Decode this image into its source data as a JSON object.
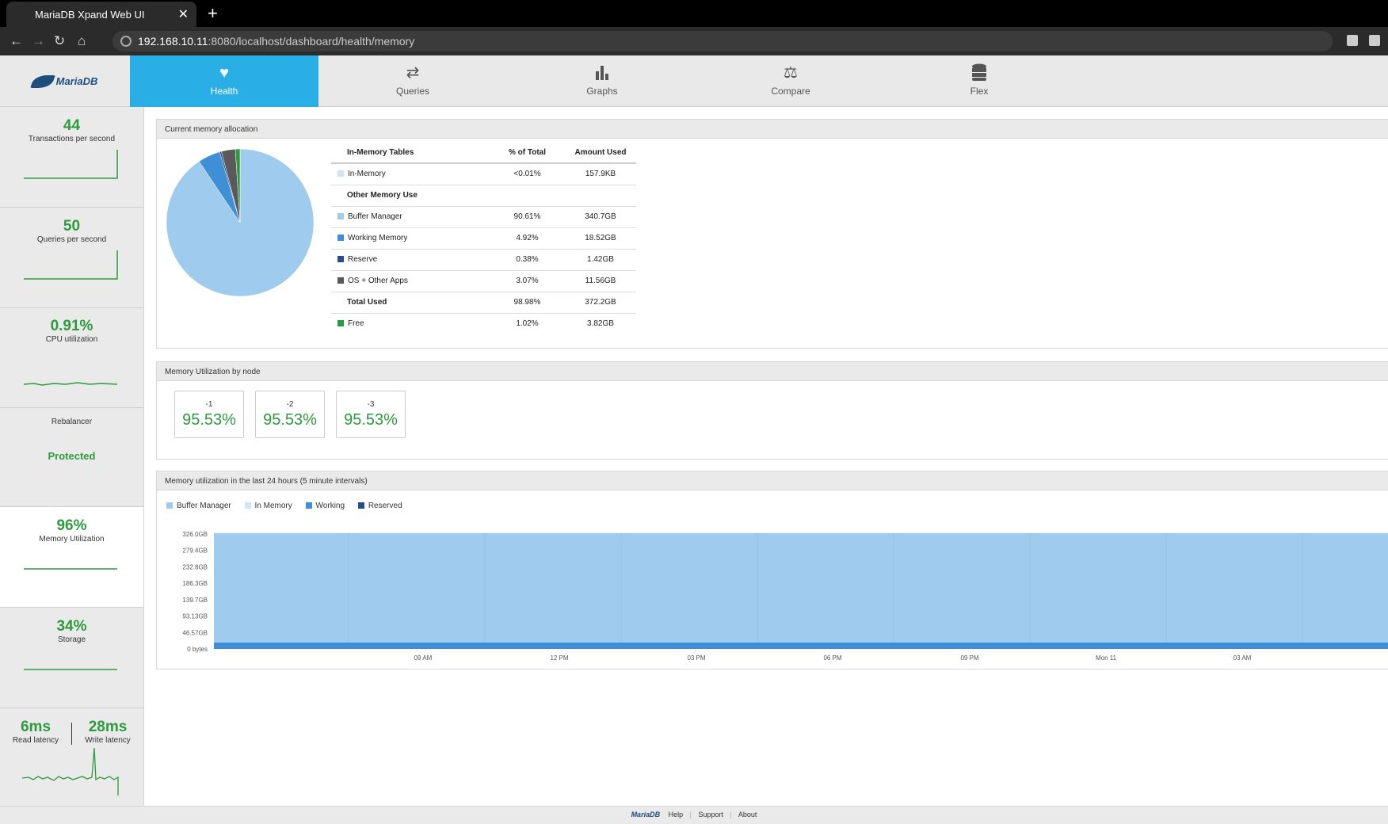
{
  "browser": {
    "tab_title": "MariaDB Xpand Web UI",
    "url_host": "192.168.10.11",
    "url_rest": ":8080/localhost/dashboard/health/memory"
  },
  "app": {
    "logo_text": "MariaDB",
    "nav": [
      {
        "label": "Health",
        "icon": "heart-pulse-icon",
        "active": true
      },
      {
        "label": "Queries",
        "icon": "arrows-icon"
      },
      {
        "label": "Graphs",
        "icon": "bar-chart-icon"
      },
      {
        "label": "Compare",
        "icon": "scales-icon"
      },
      {
        "label": "Flex",
        "icon": "database-icon"
      }
    ]
  },
  "sidebar": {
    "tps": {
      "value": "44",
      "label": "Transactions per second"
    },
    "qps": {
      "value": "50",
      "label": "Queries per second"
    },
    "cpu": {
      "value": "0.91%",
      "label": "CPU utilization"
    },
    "rebalancer": {
      "label": "Rebalancer",
      "value": "Protected"
    },
    "memory": {
      "value": "96%",
      "label": "Memory Utilization"
    },
    "storage": {
      "value": "34%",
      "label": "Storage"
    },
    "latency": {
      "read_value": "6ms",
      "read_label": "Read latency",
      "write_value": "28ms",
      "write_label": "Write latency"
    }
  },
  "allocation": {
    "title": "Current memory allocation",
    "headers": {
      "col1": "In-Memory Tables",
      "col2": "% of Total",
      "col3": "Amount Used"
    },
    "in_memory": {
      "name": "In-Memory",
      "pct": "<0.01%",
      "amount": "157.9KB"
    },
    "other_heading": "Other Memory Use",
    "rows": [
      {
        "name": "Buffer Manager",
        "pct": "90.61%",
        "amount": "340.7GB"
      },
      {
        "name": "Working Memory",
        "pct": "4.92%",
        "amount": "18.52GB"
      },
      {
        "name": "Reserve",
        "pct": "0.38%",
        "amount": "1.42GB"
      },
      {
        "name": "OS + Other Apps",
        "pct": "3.07%",
        "amount": "11.56GB"
      }
    ],
    "total": {
      "name": "Total Used",
      "pct": "98.98%",
      "amount": "372.2GB"
    },
    "free": {
      "name": "Free",
      "pct": "1.02%",
      "amount": "3.82GB"
    },
    "colors": {
      "in_memory": "#cfe6f7",
      "buffer": "#9ecbee",
      "working": "#3f8fd6",
      "reserve": "#2d4a8a",
      "os": "#5a5a5a",
      "free": "#2e9a3e"
    }
  },
  "nodes": {
    "title": "Memory Utilization by node",
    "items": [
      {
        "label": "-1",
        "value": "95.53%"
      },
      {
        "label": "-2",
        "value": "95.53%"
      },
      {
        "label": "-3",
        "value": "95.53%"
      }
    ]
  },
  "history": {
    "title": "Memory utilization in the last 24 hours (5 minute intervals)",
    "legend": [
      {
        "name": "Buffer Manager",
        "color": "#9ecbee"
      },
      {
        "name": "In Memory",
        "color": "#cfe6f7"
      },
      {
        "name": "Working",
        "color": "#3f8fd6"
      },
      {
        "name": "Reserved",
        "color": "#2d4a8a"
      }
    ]
  },
  "chart_data": [
    {
      "type": "pie",
      "categories": [
        "In-Memory",
        "Buffer Manager",
        "Working Memory",
        "Reserve",
        "OS + Other Apps",
        "Free"
      ],
      "values": [
        0.01,
        90.61,
        4.92,
        0.38,
        3.07,
        1.02
      ]
    },
    {
      "type": "area",
      "x": [
        "09 AM",
        "12 PM",
        "03 PM",
        "06 PM",
        "09 PM",
        "Mon 11",
        "03 AM"
      ],
      "yticks": [
        "326.0GB",
        "279.4GB",
        "232.8GB",
        "186.3GB",
        "139.7GB",
        "93.13GB",
        "46.57GB",
        "0 bytes"
      ],
      "ylim": [
        0,
        372.6
      ],
      "series": [
        {
          "name": "Working",
          "values": [
            18.52,
            18.52,
            18.52,
            18.52,
            18.52,
            18.52,
            18.52
          ]
        },
        {
          "name": "Buffer Manager",
          "values": [
            340.7,
            340.7,
            340.7,
            340.7,
            340.7,
            340.7,
            340.7
          ]
        }
      ]
    }
  ],
  "footer": {
    "logo": "MariaDB",
    "links": [
      "Help",
      "Support",
      "About"
    ]
  }
}
